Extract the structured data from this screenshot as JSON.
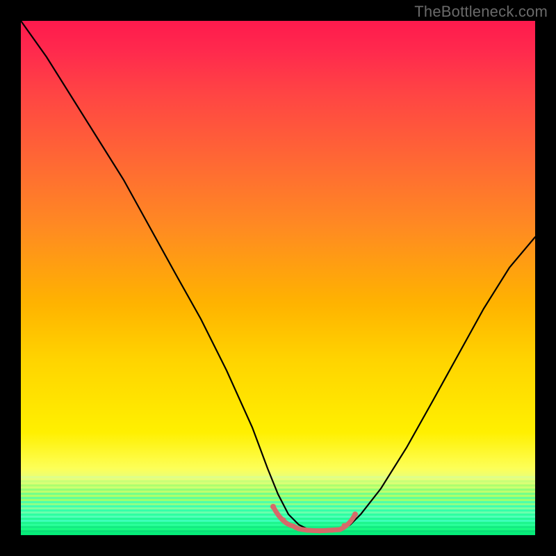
{
  "watermark": {
    "text": "TheBottleneck.com"
  },
  "chart_data": {
    "type": "line",
    "title": "",
    "xlabel": "",
    "ylabel": "",
    "xlim": [
      0,
      100
    ],
    "ylim": [
      0,
      100
    ],
    "grid": false,
    "legend": false,
    "background_gradient": {
      "direction": "vertical",
      "stops": [
        {
          "pos": 0.0,
          "color": "#ff1a4d"
        },
        {
          "pos": 0.28,
          "color": "#ff6a33"
        },
        {
          "pos": 0.55,
          "color": "#ffb300"
        },
        {
          "pos": 0.8,
          "color": "#fff000"
        },
        {
          "pos": 0.93,
          "color": "#a0ff6a"
        },
        {
          "pos": 1.0,
          "color": "#00e876"
        }
      ]
    },
    "series": [
      {
        "name": "bottleneck-curve",
        "color": "#000000",
        "x": [
          0,
          5,
          10,
          15,
          20,
          25,
          30,
          35,
          40,
          45,
          48,
          50,
          52,
          54,
          56,
          58,
          60,
          62,
          64,
          66,
          70,
          75,
          80,
          85,
          90,
          95,
          100
        ],
        "y": [
          100,
          93,
          85,
          77,
          69,
          60,
          51,
          42,
          32,
          21,
          13,
          8,
          4,
          2,
          1,
          1,
          1,
          1,
          2,
          4,
          9,
          17,
          26,
          35,
          44,
          52,
          58
        ]
      },
      {
        "name": "valley-highlight",
        "color": "#d66a6a",
        "stroke_width": 6,
        "x": [
          49,
          51,
          53,
          55,
          57,
          59,
          61,
          63,
          65
        ],
        "y": [
          5.5,
          3.0,
          1.8,
          1.2,
          1.0,
          1.0,
          1.2,
          2.0,
          4.0
        ]
      }
    ],
    "annotations": [
      {
        "text": "TheBottleneck.com",
        "position": "top-right",
        "color": "#6a6a6a"
      }
    ]
  }
}
